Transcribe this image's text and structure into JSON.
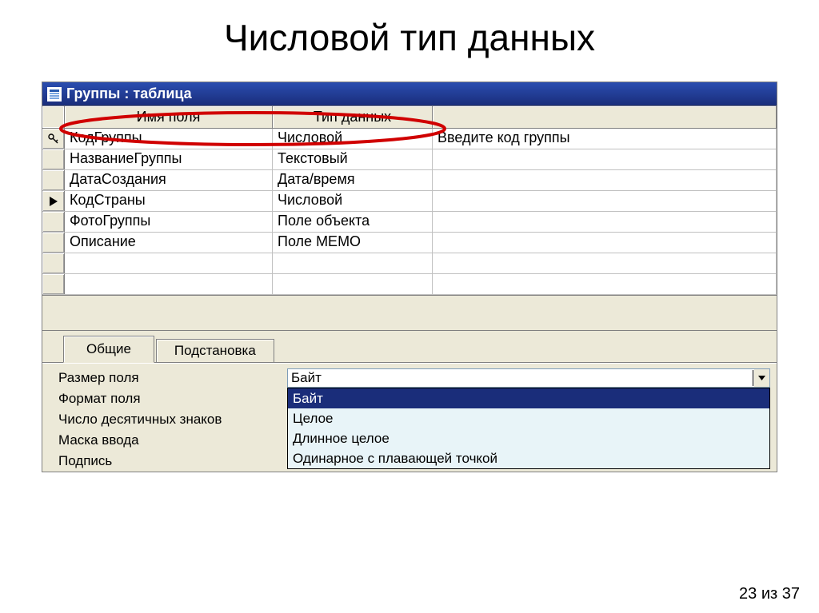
{
  "slide": {
    "title": "Числовой тип данных",
    "page_label": "23 из 37"
  },
  "window": {
    "title": "Группы : таблица"
  },
  "grid": {
    "headers": {
      "name": "Имя поля",
      "type": "Тип данных",
      "desc": ""
    },
    "rows": [
      {
        "marker": "key",
        "name": "КодГруппы",
        "type": "Числовой",
        "desc": "Введите код группы"
      },
      {
        "marker": "",
        "name": "НазваниеГруппы",
        "type": "Текстовый",
        "desc": ""
      },
      {
        "marker": "",
        "name": "ДатаСоздания",
        "type": "Дата/время",
        "desc": ""
      },
      {
        "marker": "arrow",
        "name": "КодСтраны",
        "type": "Числовой",
        "desc": ""
      },
      {
        "marker": "",
        "name": "ФотоГруппы",
        "type": "Поле объекта ",
        "desc": ""
      },
      {
        "marker": "",
        "name": "Описание",
        "type": "Поле МЕМО",
        "desc": ""
      },
      {
        "marker": "",
        "name": "",
        "type": "",
        "desc": ""
      },
      {
        "marker": "",
        "name": "",
        "type": "",
        "desc": ""
      }
    ]
  },
  "tabs": {
    "general": "Общие",
    "lookup": "Подстановка"
  },
  "props": {
    "rows": [
      {
        "label": "Размер поля"
      },
      {
        "label": "Формат поля"
      },
      {
        "label": "Число десятичных знаков"
      },
      {
        "label": "Маска ввода"
      },
      {
        "label": "Подпись"
      }
    ],
    "combo_value": "Байт",
    "dropdown": [
      "Байт",
      "Целое",
      "Длинное целое",
      "Одинарное с плавающей точкой"
    ]
  }
}
